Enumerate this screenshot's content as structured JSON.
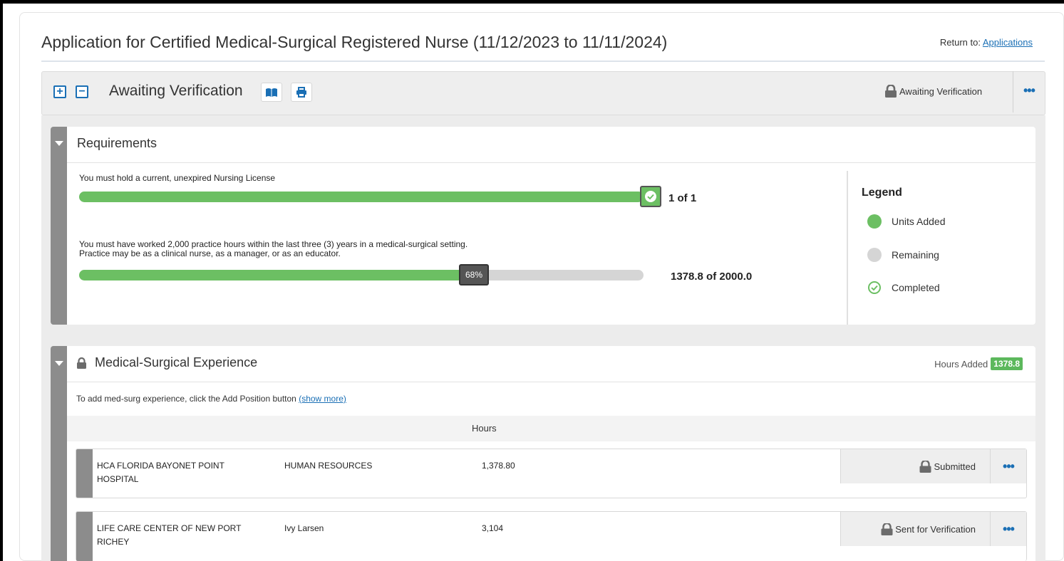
{
  "header": {
    "title": "Application for Certified Medical-Surgical Registered Nurse (11/12/2023 to 11/11/2024)",
    "return_prefix": "Return to:",
    "return_link": "Applications"
  },
  "status_bar": {
    "expand_label": "+",
    "collapse_label": "−",
    "title": "Awaiting Verification",
    "status_text": "Awaiting Verification",
    "book_icon": "book-icon",
    "print_icon": "print-icon",
    "more_label": "•••"
  },
  "requirements": {
    "title": "Requirements",
    "items": [
      {
        "text": "You must hold a current, unexpired Nursing License",
        "progress": 1.0,
        "count": "1 of 1"
      },
      {
        "text_line1": "You must have worked 2,000 practice hours within the last three (3) years in a medical-surgical setting.",
        "text_line2": "Practice may be as a clinical nurse, as a manager, or as an educator.",
        "progress": 0.68,
        "percent_label": "68%",
        "count": "1378.8 of 2000.0"
      }
    ],
    "legend": {
      "title": "Legend",
      "items": [
        {
          "label": "Units Added",
          "color": "#6cbf63"
        },
        {
          "label": "Remaining",
          "color": "#d5d5d5"
        },
        {
          "label": "Completed",
          "color": "#6cbf63"
        }
      ]
    }
  },
  "experience": {
    "title": "Medical-Surgical Experience",
    "hours_added_label": "Hours Added",
    "hours_added_value": "1378.8",
    "instruction": "To add med-surg experience, click the Add Position button",
    "show_more": "(show more)",
    "column_hours": "Hours",
    "rows": [
      {
        "employer_line1": "HCA FLORIDA BAYONET POINT",
        "employer_line2": "HOSPITAL",
        "contact": "HUMAN RESOURCES",
        "hours": "1,378.80",
        "status": "Submitted",
        "more": "•••"
      },
      {
        "employer_line1": "LIFE CARE CENTER OF NEW PORT",
        "employer_line2": "RICHEY",
        "contact": "Ivy Larsen",
        "hours": "3,104",
        "status": "Sent for Verification",
        "more": "•••"
      }
    ]
  },
  "colors": {
    "accent": "#1a6fb5",
    "success": "#6cbf63",
    "rail": "#8c8c8c"
  }
}
